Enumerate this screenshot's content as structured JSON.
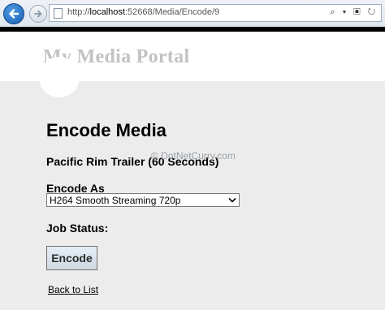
{
  "browser": {
    "url_prefix": "http://",
    "url_host": "localhost",
    "url_rest": ":52668/Media/Encode/9",
    "tools": "⌕ ▾ ▣ ↻"
  },
  "header": {
    "site_title": "My Media Portal"
  },
  "main": {
    "page_title": "Encode Media",
    "video_title": "Pacific Rim Trailer (60 Seconds)",
    "watermark": "© DotNetCurry.com",
    "encode_as_label": "Encode As",
    "encode_as_value": "H264 Smooth Streaming 720p",
    "job_status_label": "Job Status:",
    "encode_button": "Encode",
    "back_link": "Back to List"
  }
}
